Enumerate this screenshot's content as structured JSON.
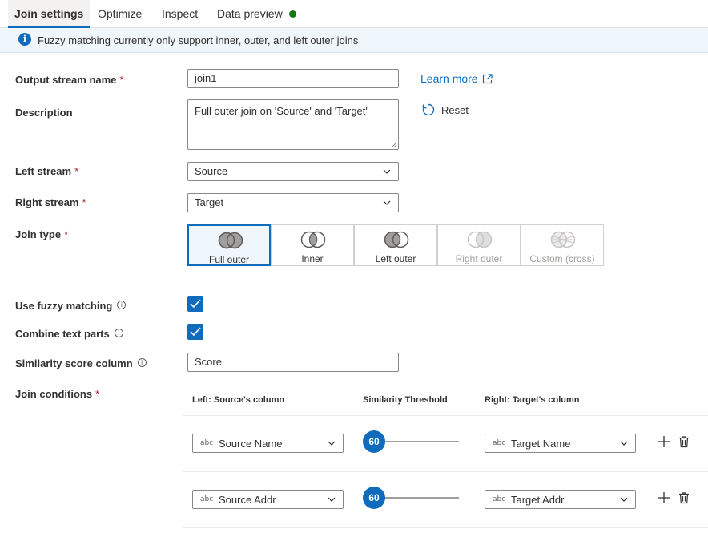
{
  "tabs": [
    {
      "label": "Join settings"
    },
    {
      "label": "Optimize"
    },
    {
      "label": "Inspect"
    },
    {
      "label": "Data preview"
    }
  ],
  "status_dot_color": "#107c10",
  "info_bar": {
    "text": "Fuzzy matching currently only support inner, outer, and left outer joins"
  },
  "form": {
    "output_stream_name": {
      "label": "Output stream name",
      "required": "*",
      "value": "join1"
    },
    "description": {
      "label": "Description",
      "value": "Full outer join on 'Source' and 'Target'"
    },
    "learn_more": {
      "label": "Learn more"
    },
    "reset": {
      "label": "Reset"
    },
    "left_stream": {
      "label": "Left stream",
      "required": "*",
      "value": "Source"
    },
    "right_stream": {
      "label": "Right stream",
      "required": "*",
      "value": "Target"
    },
    "join_type": {
      "label": "Join type",
      "required": "*",
      "options": [
        {
          "label": "Full outer",
          "state": "selected"
        },
        {
          "label": "Inner",
          "state": "enabled"
        },
        {
          "label": "Left outer",
          "state": "enabled"
        },
        {
          "label": "Right outer",
          "state": "disabled"
        },
        {
          "label": "Custom (cross)",
          "state": "disabled"
        }
      ]
    },
    "use_fuzzy_matching": {
      "label": "Use fuzzy matching",
      "checked": true
    },
    "combine_text_parts": {
      "label": "Combine text parts",
      "checked": true
    },
    "similarity_score_column": {
      "label": "Similarity score column",
      "value": "Score"
    },
    "join_conditions": {
      "label": "Join conditions",
      "required": "*",
      "headers": {
        "left": "Left: Source's column",
        "threshold": "Similarity Threshold",
        "right": "Right: Target's column"
      },
      "rows": [
        {
          "type": "abc",
          "left": "Source Name",
          "threshold": "60",
          "right": "Target Name"
        },
        {
          "type": "abc",
          "left": "Source Addr",
          "threshold": "60",
          "right": "Target Addr"
        }
      ]
    }
  },
  "icons": {
    "info": "info-icon",
    "external_link": "external-link-icon",
    "reset": "reset-icon",
    "help": "help-icon",
    "chevron": "chevron-down-icon",
    "add": "add-icon",
    "delete": "trash-icon"
  },
  "colors": {
    "accent": "#0f6cbd",
    "required": "#a4262c",
    "info_bg": "#eff6fc"
  }
}
